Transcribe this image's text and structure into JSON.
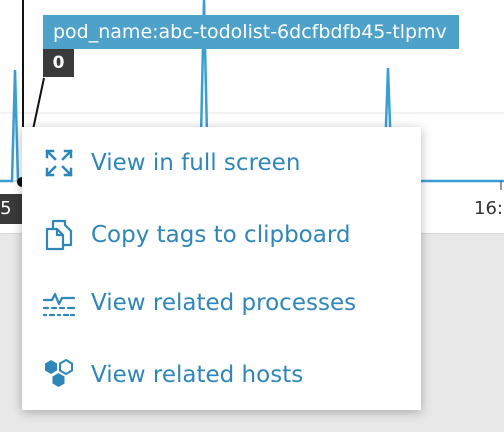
{
  "tooltip": {
    "series_label": "pod_name:abc-todolist-6dcfbdfb45-tlpmv",
    "value": "0"
  },
  "axis": {
    "left_tick_fragment": ":5",
    "right_tick_fragment": "16:"
  },
  "menu": {
    "items": [
      {
        "label": "View in full screen",
        "icon": "fullscreen-icon"
      },
      {
        "label": "Copy tags to clipboard",
        "icon": "copy-icon"
      },
      {
        "label": "View related processes",
        "icon": "processes-icon"
      },
      {
        "label": "View related hosts",
        "icon": "hosts-icon"
      }
    ]
  },
  "colors": {
    "accent": "#2f86b8",
    "series": "#3a9fd0",
    "tooltip_bg": "#4ea1c9",
    "badge_bg": "#3a3a3a"
  }
}
